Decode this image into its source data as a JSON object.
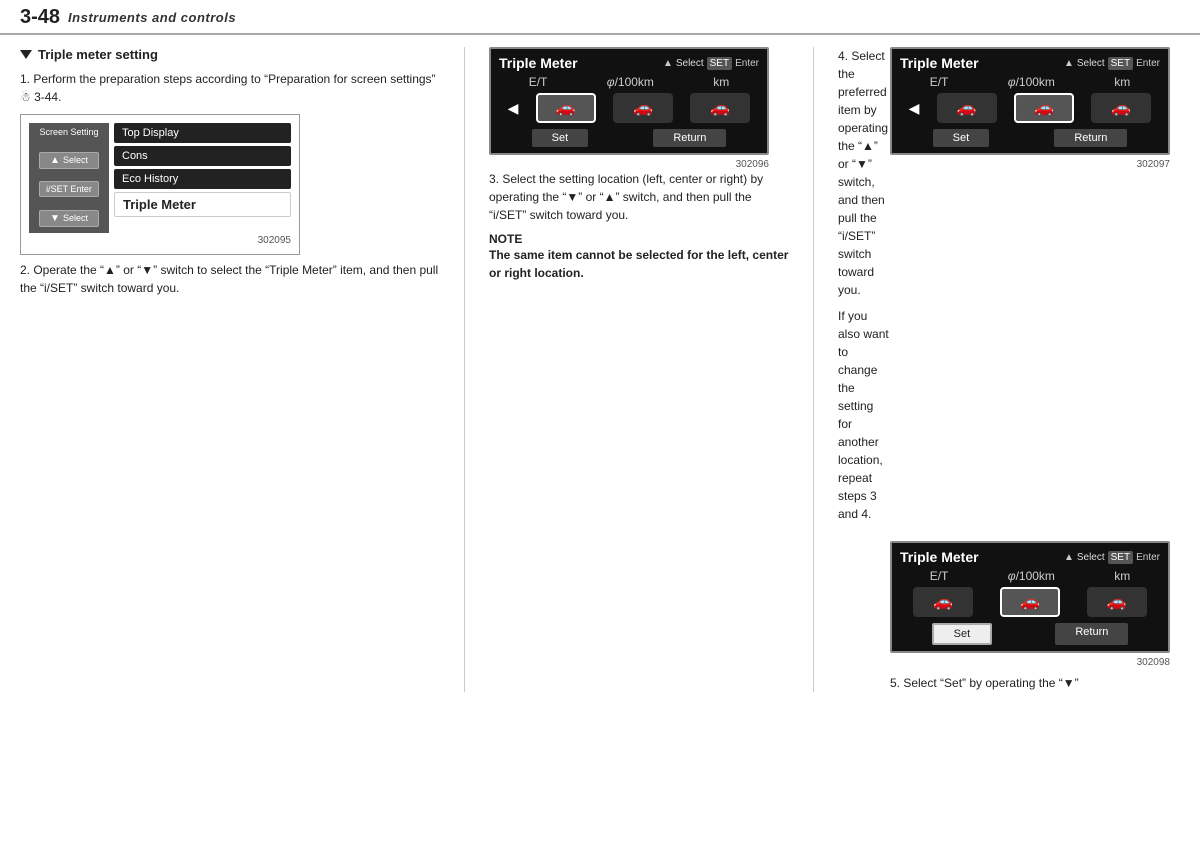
{
  "header": {
    "section": "3-48",
    "title": "Instruments and controls"
  },
  "left": {
    "heading": "Triple meter setting",
    "step1": "1.  Perform the preparation steps according to “Preparation for screen settings”",
    "step1_ref": "☃ 3-44.",
    "screen_setting": {
      "label": "Screen Setting",
      "btn_up": "▲ Select",
      "btn_enter": "i/SET Enter",
      "btn_down": "▼ Select",
      "menu_items": [
        "Top Display",
        "Cons",
        "Eco History",
        "Triple Meter"
      ],
      "active_item": "Triple Meter",
      "diagram_num": "302095"
    },
    "step2": "2.  Operate the “▲” or “▼” switch to select the “Triple Meter” item, and then pull the “i/SET” switch toward you."
  },
  "center": {
    "step3_heading": "3.  Select the setting location (left, center or right) by operating the “▼” or “▲” switch, and then pull the “i/SET” switch toward you.",
    "note_title": "NOTE",
    "note_text": "The same item cannot be selected for the left, center or right location.",
    "diagram1": {
      "title": "Triple Meter",
      "select_label": "▲Select",
      "enter_label": "SET Enter",
      "data": [
        "E/T",
        "φ/100km",
        "km"
      ],
      "diagram_num": "302096",
      "footer": [
        "Set",
        "Return"
      ]
    }
  },
  "right": {
    "step4": "4.  Select the preferred item by operating the “▲” or “▼” switch, and then pull the “i/SET” switch toward you.",
    "step4b": "If you also want to change the setting for another location, repeat steps 3 and 4.",
    "diagram2": {
      "title": "Triple Meter",
      "select_label": "▲Select",
      "enter_label": "SET Enter",
      "data": [
        "E/T",
        "φ/100km",
        "km"
      ],
      "diagram_num": "302097",
      "footer": [
        "Set",
        "Return"
      ]
    },
    "diagram3": {
      "title": "Triple Meter",
      "select_label": "▲Select",
      "enter_label": "SET Enter",
      "data": [
        "E/T",
        "φ/100km",
        "km"
      ],
      "diagram_num": "302098",
      "footer": [
        "Set",
        "Return"
      ],
      "set_selected": true
    },
    "step5": "5.  Select “Set” by operating the “▼”"
  }
}
